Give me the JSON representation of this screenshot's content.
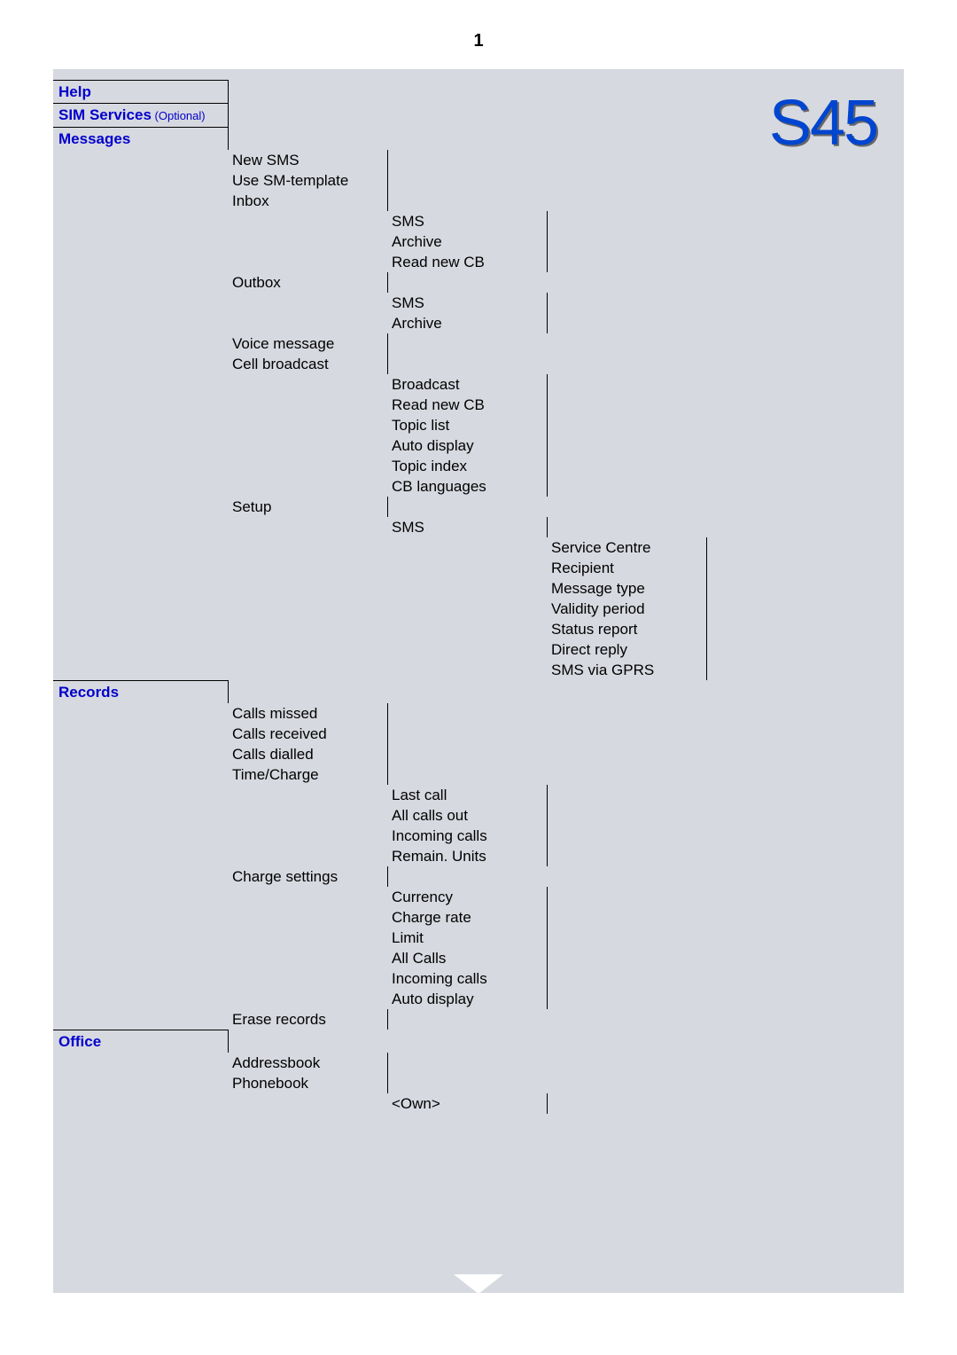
{
  "pageNumber": "1",
  "logo": "S45",
  "headers": {
    "help": "Help",
    "simServices": "SIM Services",
    "simOptional": " (Optional)",
    "messages": "Messages",
    "records": "Records",
    "office": "Office"
  },
  "messages": {
    "newSms": "New SMS",
    "useTemplate": "Use SM-template",
    "inbox": "Inbox",
    "inboxSub": {
      "sms": "SMS",
      "archive": "Archive",
      "readNewCb": "Read new CB"
    },
    "outbox": "Outbox",
    "outboxSub": {
      "sms": "SMS",
      "archive": "Archive"
    },
    "voiceMessage": "Voice message",
    "cellBroadcast": "Cell broadcast",
    "cbSub": {
      "broadcast": "Broadcast",
      "readNewCb": "Read new CB",
      "topicList": "Topic list",
      "autoDisplay": "Auto display",
      "topicIndex": "Topic index",
      "cbLanguages": "CB languages"
    },
    "setup": "Setup",
    "setupSub": {
      "sms": "SMS",
      "smsSub": {
        "serviceCentre": "Service Centre",
        "recipient": "Recipient",
        "messageType": "Message type",
        "validityPeriod": "Validity period",
        "statusReport": "Status report",
        "directReply": "Direct reply",
        "smsViaGprs": "SMS via GPRS"
      }
    }
  },
  "records": {
    "callsMissed": "Calls missed",
    "callsReceived": "Calls received",
    "callsDialled": "Calls dialled",
    "timeCharge": "Time/Charge",
    "tcSub": {
      "lastCall": "Last call",
      "allCallsOut": "All calls out",
      "incomingCalls": "Incoming calls",
      "remainUnits": "Remain. Units"
    },
    "chargeSettings": "Charge settings",
    "csSub": {
      "currency": "Currency",
      "chargeRate": "Charge rate",
      "limit": "Limit",
      "allCalls": "All Calls",
      "incomingCalls": "Incoming calls",
      "autoDisplay": "Auto display"
    },
    "eraseRecords": "Erase records"
  },
  "office": {
    "addressbook": "Addressbook",
    "phonebook": "Phonebook",
    "pbSub": {
      "own": "<Own>"
    }
  }
}
